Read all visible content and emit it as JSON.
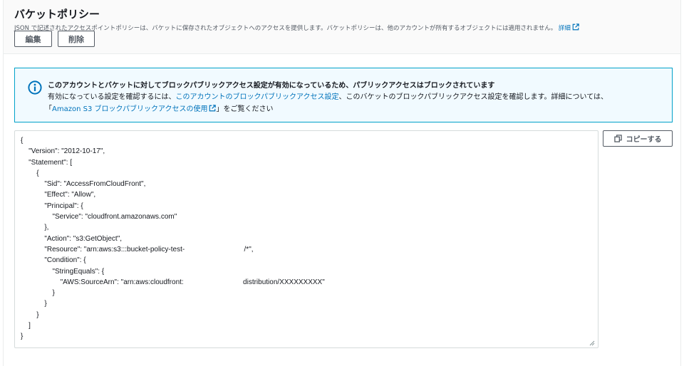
{
  "header": {
    "title": "バケットポリシー",
    "description": "JSON で記述されたアクセスポイントポリシーは、バケットに保存されたオブジェクトへのアクセスを提供します。バケットポリシーは、他のアカウントが所有するオブジェクトには適用されません。",
    "details_link": "詳細",
    "edit_label": "編集",
    "delete_label": "削除"
  },
  "alert": {
    "title": "このアカウントとバケットに対してブロックパブリックアクセス設定が有効になっているため、パブリックアクセスはブロックされています",
    "line2_prefix": "有効になっている設定を確認するには、",
    "line2_link": "このアカウントのブロックパブリックアクセス設定",
    "line2_suffix": "、このバケットのブロックパブリックアクセス設定を確認します。詳細については、",
    "line3_open": "「",
    "line3_link": "Amazon S3 ブロックパブリックアクセスの使用",
    "line3_suffix": "」をご覧ください"
  },
  "editor": {
    "policy_text": "{\n    \"Version\": \"2012-10-17\",\n    \"Statement\": [\n        {\n            \"Sid\": \"AccessFromCloudFront\",\n            \"Effect\": \"Allow\",\n            \"Principal\": {\n                \"Service\": \"cloudfront.amazonaws.com\"\n            },\n            \"Action\": \"s3:GetObject\",\n            \"Resource\": \"arn:aws:s3:::bucket-policy-test-                              /*\",\n            \"Condition\": {\n                \"StringEquals\": {\n                    \"AWS:SourceArn\": \"arn:aws:cloudfront:                              distribution/XXXXXXXXX\"\n                }\n            }\n        }\n    ]\n}",
    "copy_label": "コピーする"
  },
  "icons": {
    "info": "info-icon",
    "external_link": "external-link-icon",
    "copy": "copy-icon",
    "resize": "resize-grip-icon"
  },
  "colors": {
    "link": "#0073bb",
    "alert_border": "#00a1c9",
    "alert_bg": "#f1faff",
    "info_icon": "#0073bb"
  }
}
